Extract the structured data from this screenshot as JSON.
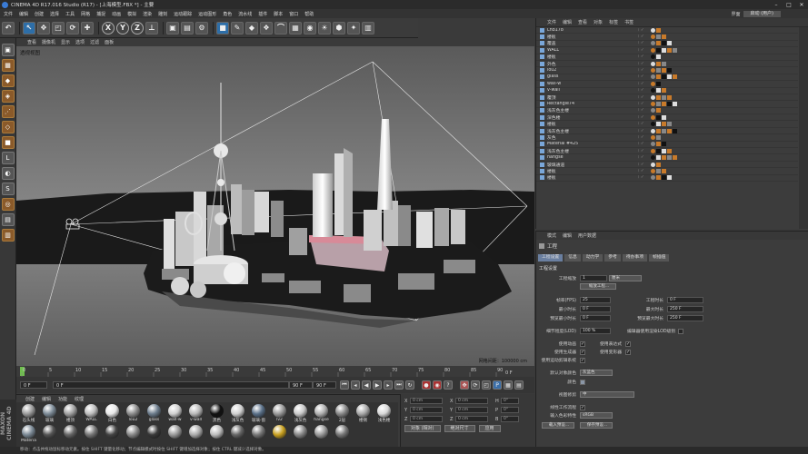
{
  "window": {
    "title": "CINEMA 4D R17.016 Studio (R17) - [上海模型.FBX *] - 主要"
  },
  "menubar": {
    "items": [
      "文件",
      "编辑",
      "创建",
      "选择",
      "工具",
      "网格",
      "捕捉",
      "动画",
      "模拟",
      "渲染",
      "雕刻",
      "运动跟踪",
      "运动图形",
      "角色",
      "流水线",
      "插件",
      "脚本",
      "窗口",
      "帮助"
    ],
    "layout_label": "界面",
    "layout_value": "启动 (用户)"
  },
  "toolbar": {
    "axis_x": "X",
    "axis_y": "Y",
    "axis_z": "Z"
  },
  "viewport": {
    "menu": [
      "查看",
      "摄像机",
      "显示",
      "选项",
      "过滤",
      "面板"
    ],
    "label": "透视视图",
    "grid": "网格间距：100000 cm"
  },
  "timeline": {
    "ticks": [
      "0",
      "5",
      "10",
      "15",
      "20",
      "25",
      "30",
      "35",
      "40",
      "45",
      "50",
      "55",
      "60",
      "65",
      "70",
      "75",
      "80",
      "85",
      "90"
    ],
    "end_frame": "0 F"
  },
  "transport": {
    "start": "0 F",
    "current": "0 F",
    "end": "90 F",
    "end2": "90 F"
  },
  "material_manager": {
    "menu": [
      "创建",
      "编辑",
      "功能",
      "纹理"
    ],
    "materials": [
      {
        "name": "石头线",
        "color": "#9a9a9a"
      },
      {
        "name": "玻璃",
        "color": "#7c8a96"
      },
      {
        "name": "楼顶",
        "color": "#a0a0a0"
      },
      {
        "name": "WALL",
        "color": "#bdbdbd"
      },
      {
        "name": "白色",
        "color": "#e8e8e8"
      },
      {
        "name": "lou2",
        "color": "#8c8c8c"
      },
      {
        "name": "glass",
        "color": "#6c7c8c"
      },
      {
        "name": "wall-w",
        "color": "#d0d0d0"
      },
      {
        "name": "v-wall",
        "color": "#b8b8b8"
      },
      {
        "name": "黑色",
        "color": "#111111"
      },
      {
        "name": "浅灰色",
        "color": "#cfcfcf"
      },
      {
        "name": "玻璃-窗",
        "color": "#5a7088"
      },
      {
        "name": "lv2",
        "color": "#999999"
      },
      {
        "name": "浅灰色",
        "color": "#c8c8c8"
      },
      {
        "name": "hangse",
        "color": "#b0b0b0"
      },
      {
        "name": "2层",
        "color": "#888888"
      },
      {
        "name": "楼侧",
        "color": "#a8a8a8"
      },
      {
        "name": "浅色楼",
        "color": "#d8d8d8"
      },
      {
        "name": "Materia",
        "color": "#7a8894"
      },
      {
        "name": "",
        "color": "#555555"
      },
      {
        "name": "",
        "color": "#666666"
      },
      {
        "name": "",
        "color": "#777777"
      },
      {
        "name": "",
        "color": "#444444"
      },
      {
        "name": "",
        "color": "#888888"
      },
      {
        "name": "",
        "color": "#3a3a3a"
      },
      {
        "name": "",
        "color": "#999999"
      },
      {
        "name": "",
        "color": "#aaaaaa"
      },
      {
        "name": "",
        "color": "#bbbbbb"
      },
      {
        "name": "",
        "color": "#666666"
      },
      {
        "name": "",
        "color": "#777777"
      },
      {
        "name": "",
        "color": "#c8a020"
      },
      {
        "name": "",
        "color": "#888888"
      },
      {
        "name": "",
        "color": "#999999"
      },
      {
        "name": "",
        "color": "#777777"
      }
    ]
  },
  "coords": {
    "rows": [
      {
        "a": "X",
        "av": "0 cm",
        "b": "X",
        "bv": "0 cm",
        "c": "H",
        "cv": "0°"
      },
      {
        "a": "Y",
        "av": "0 cm",
        "b": "Y",
        "bv": "0 cm",
        "c": "P",
        "cv": "0°"
      },
      {
        "a": "Z",
        "av": "0 cm",
        "b": "Z",
        "bv": "0 cm",
        "c": "B",
        "cv": "0°"
      }
    ],
    "mode1": "对象 (相对)",
    "mode2": "绝对尺寸",
    "apply": "应用"
  },
  "object_manager": {
    "menu": [
      "文件",
      "编辑",
      "查看",
      "对象",
      "标签",
      "书签"
    ],
    "objects": [
      "Lnb178",
      "楼板",
      "覆盖",
      "WALL",
      "楼板",
      "外色",
      "lou2",
      "glass",
      "wall-w",
      "v-wall",
      "覆顶",
      "Rectangle74",
      "浅灰色主楼",
      "深色楼",
      "楼板",
      "浅灰色主楼",
      "灰色",
      "Material #425",
      "浅灰色主楼",
      "hangse",
      "玻璃通道",
      "楼板",
      "楼板"
    ]
  },
  "attribute_manager": {
    "menu": [
      "模式",
      "编辑",
      "用户数据"
    ],
    "title": "工程",
    "tabs": [
      "工程设置",
      "信息",
      "动力学",
      "参考",
      "待办事项",
      "帧插值"
    ],
    "active_tab": "工程设置",
    "section1": "工程设置",
    "fields": {
      "scale_label": "工程缩放",
      "scale_value": "1",
      "scale_unit": "厘米",
      "scale_btn": "缩放工程...",
      "fps_label": "帧率(FPS)",
      "fps_value": "25",
      "min_label": "最小时长",
      "min_value": "0 F",
      "preview_min_label": "预览最小时长",
      "preview_min_value": "0 F",
      "lod_label": "细节程度(LOD)",
      "lod_value": "100 %",
      "duration_label": "工程时长",
      "duration_value": "0 F",
      "max_label": "最大时长",
      "max_value": "250 F",
      "preview_max_label": "预览最大时长",
      "preview_max_value": "250 F",
      "lod_render_label": "编辑器使用渲染LOD级别",
      "anim_label": "使用动画",
      "expr_label": "使用表达式",
      "gen_label": "使用生成器",
      "deform_label": "使用变形器",
      "motion_label": "使用运动剪辑系统",
      "default_color_label": "默认对象颜色",
      "default_color_value": "灰蓝色",
      "color_label": "颜色",
      "view_clip_label": "视图修剪",
      "view_clip_value": "中",
      "linear_label": "线性工作流程",
      "input_color_label": "输入色彩特性",
      "input_color_value": "sRGB",
      "load_preset": "载入预设...",
      "save_preset": "保存预设..."
    }
  },
  "status": "移动：点击并拖动鼠标移动元素。按住 SHIFT 键量化移动；节点编辑模式时按住 SHIFT 键增加选择对象；按住 CTRL 键减少选择对象。",
  "brand": "MAXON CINEMA 4D"
}
